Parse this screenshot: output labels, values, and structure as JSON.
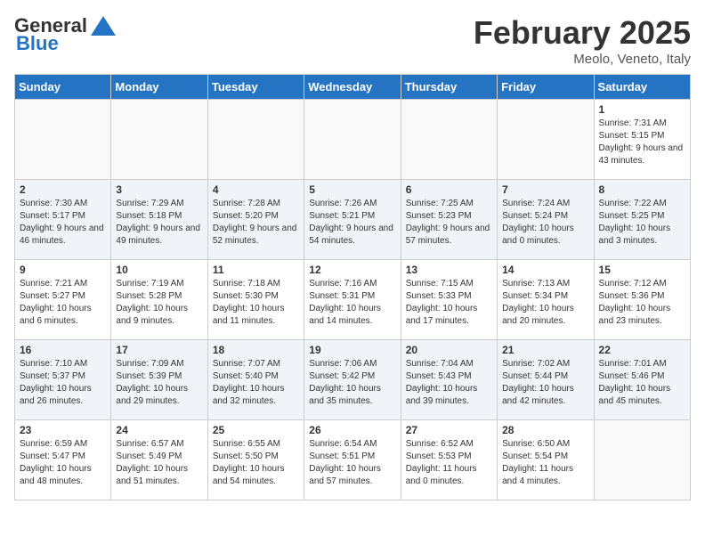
{
  "header": {
    "logo_general": "General",
    "logo_blue": "Blue",
    "month_title": "February 2025",
    "location": "Meolo, Veneto, Italy"
  },
  "calendar": {
    "days_of_week": [
      "Sunday",
      "Monday",
      "Tuesday",
      "Wednesday",
      "Thursday",
      "Friday",
      "Saturday"
    ],
    "weeks": [
      [
        {
          "day": "",
          "info": ""
        },
        {
          "day": "",
          "info": ""
        },
        {
          "day": "",
          "info": ""
        },
        {
          "day": "",
          "info": ""
        },
        {
          "day": "",
          "info": ""
        },
        {
          "day": "",
          "info": ""
        },
        {
          "day": "1",
          "info": "Sunrise: 7:31 AM\nSunset: 5:15 PM\nDaylight: 9 hours and 43 minutes."
        }
      ],
      [
        {
          "day": "2",
          "info": "Sunrise: 7:30 AM\nSunset: 5:17 PM\nDaylight: 9 hours and 46 minutes."
        },
        {
          "day": "3",
          "info": "Sunrise: 7:29 AM\nSunset: 5:18 PM\nDaylight: 9 hours and 49 minutes."
        },
        {
          "day": "4",
          "info": "Sunrise: 7:28 AM\nSunset: 5:20 PM\nDaylight: 9 hours and 52 minutes."
        },
        {
          "day": "5",
          "info": "Sunrise: 7:26 AM\nSunset: 5:21 PM\nDaylight: 9 hours and 54 minutes."
        },
        {
          "day": "6",
          "info": "Sunrise: 7:25 AM\nSunset: 5:23 PM\nDaylight: 9 hours and 57 minutes."
        },
        {
          "day": "7",
          "info": "Sunrise: 7:24 AM\nSunset: 5:24 PM\nDaylight: 10 hours and 0 minutes."
        },
        {
          "day": "8",
          "info": "Sunrise: 7:22 AM\nSunset: 5:25 PM\nDaylight: 10 hours and 3 minutes."
        }
      ],
      [
        {
          "day": "9",
          "info": "Sunrise: 7:21 AM\nSunset: 5:27 PM\nDaylight: 10 hours and 6 minutes."
        },
        {
          "day": "10",
          "info": "Sunrise: 7:19 AM\nSunset: 5:28 PM\nDaylight: 10 hours and 9 minutes."
        },
        {
          "day": "11",
          "info": "Sunrise: 7:18 AM\nSunset: 5:30 PM\nDaylight: 10 hours and 11 minutes."
        },
        {
          "day": "12",
          "info": "Sunrise: 7:16 AM\nSunset: 5:31 PM\nDaylight: 10 hours and 14 minutes."
        },
        {
          "day": "13",
          "info": "Sunrise: 7:15 AM\nSunset: 5:33 PM\nDaylight: 10 hours and 17 minutes."
        },
        {
          "day": "14",
          "info": "Sunrise: 7:13 AM\nSunset: 5:34 PM\nDaylight: 10 hours and 20 minutes."
        },
        {
          "day": "15",
          "info": "Sunrise: 7:12 AM\nSunset: 5:36 PM\nDaylight: 10 hours and 23 minutes."
        }
      ],
      [
        {
          "day": "16",
          "info": "Sunrise: 7:10 AM\nSunset: 5:37 PM\nDaylight: 10 hours and 26 minutes."
        },
        {
          "day": "17",
          "info": "Sunrise: 7:09 AM\nSunset: 5:39 PM\nDaylight: 10 hours and 29 minutes."
        },
        {
          "day": "18",
          "info": "Sunrise: 7:07 AM\nSunset: 5:40 PM\nDaylight: 10 hours and 32 minutes."
        },
        {
          "day": "19",
          "info": "Sunrise: 7:06 AM\nSunset: 5:42 PM\nDaylight: 10 hours and 35 minutes."
        },
        {
          "day": "20",
          "info": "Sunrise: 7:04 AM\nSunset: 5:43 PM\nDaylight: 10 hours and 39 minutes."
        },
        {
          "day": "21",
          "info": "Sunrise: 7:02 AM\nSunset: 5:44 PM\nDaylight: 10 hours and 42 minutes."
        },
        {
          "day": "22",
          "info": "Sunrise: 7:01 AM\nSunset: 5:46 PM\nDaylight: 10 hours and 45 minutes."
        }
      ],
      [
        {
          "day": "23",
          "info": "Sunrise: 6:59 AM\nSunset: 5:47 PM\nDaylight: 10 hours and 48 minutes."
        },
        {
          "day": "24",
          "info": "Sunrise: 6:57 AM\nSunset: 5:49 PM\nDaylight: 10 hours and 51 minutes."
        },
        {
          "day": "25",
          "info": "Sunrise: 6:55 AM\nSunset: 5:50 PM\nDaylight: 10 hours and 54 minutes."
        },
        {
          "day": "26",
          "info": "Sunrise: 6:54 AM\nSunset: 5:51 PM\nDaylight: 10 hours and 57 minutes."
        },
        {
          "day": "27",
          "info": "Sunrise: 6:52 AM\nSunset: 5:53 PM\nDaylight: 11 hours and 0 minutes."
        },
        {
          "day": "28",
          "info": "Sunrise: 6:50 AM\nSunset: 5:54 PM\nDaylight: 11 hours and 4 minutes."
        },
        {
          "day": "",
          "info": ""
        }
      ]
    ]
  }
}
